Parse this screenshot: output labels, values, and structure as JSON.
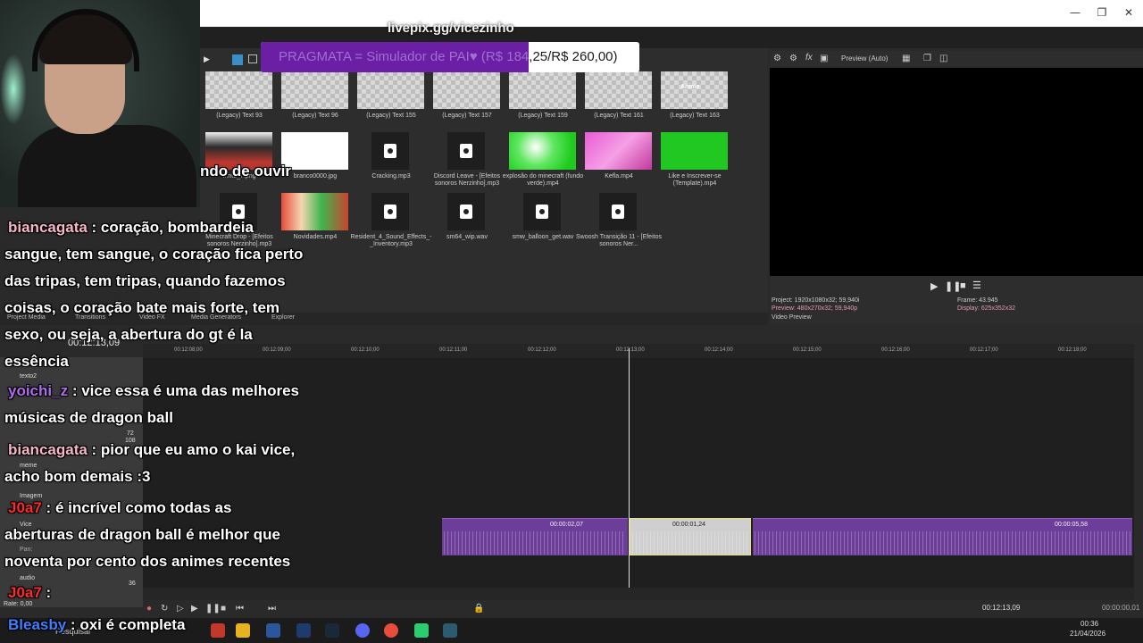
{
  "overlay": {
    "livepix": "livepix.gg/vicezinho",
    "donation": {
      "text": "PRAGMATA = Simulador de PAI♥ (R$ 184,25/R$ 260,00)",
      "text_pre": "PRAGMATA = Simulador de PAI♥ (R$ 184",
      "text_post": ",25/R$ 260,00)",
      "progress_fraction": 0.7087,
      "fill_color": "#6a1fa5"
    }
  },
  "chat": {
    "partial_line": "ndo de ouvir",
    "messages": [
      {
        "user": "biancagata",
        "user_color": "#f7b7c7",
        "lines": [
          "coração, bombardeia",
          "sangue, tem sangue, o coração fica perto",
          "das tripas, tem tripas, quando fazemos",
          "coisas, o coração bate mais forte, tem",
          "sexo, ou seja, a abertura do gt é la",
          "essência"
        ]
      },
      {
        "user": "yoichi_z",
        "user_color": "#b06cf0",
        "lines": [
          "vice essa é uma das melhores",
          "músicas de dragon ball"
        ]
      },
      {
        "user": "biancagata",
        "user_color": "#f7b7c7",
        "lines": [
          "pior que eu amo o kai vice,",
          "acho bom demais :3"
        ]
      },
      {
        "user": "J0a7",
        "user_color": "#ff2a2a",
        "lines": [
          "é incrível como todas as",
          "aberturas de dragon ball é melhor que",
          "noventa por cento dos animes recentes"
        ]
      },
      {
        "user": "J0a7",
        "user_color": "#ff2a2a",
        "lines": [
          ":"
        ]
      },
      {
        "user": "Bleasby",
        "user_color": "#3f7fff",
        "lines": [
          "oxi é completa"
        ]
      }
    ]
  },
  "window": {
    "minimize_icon": "minimize-icon",
    "restore_icon": "restore-icon",
    "close_icon": "close-icon"
  },
  "media": {
    "items": [
      {
        "label": "(Legacy) Text 93",
        "kind": "checker"
      },
      {
        "label": "(Legacy) Text 96",
        "kind": "checker"
      },
      {
        "label": "(Legacy) Text 155",
        "kind": "checker"
      },
      {
        "label": "(Legacy) Text 157",
        "kind": "checker"
      },
      {
        "label": "(Legacy) Text 159",
        "kind": "checker"
      },
      {
        "label": "(Legacy) Text 161",
        "kind": "checker"
      },
      {
        "label": "(Legacy) Text 163",
        "kind": "checker"
      },
      {
        "label": "...nte_7.png",
        "kind": "character"
      },
      {
        "label": "branco0000.jpg",
        "kind": "white"
      },
      {
        "label": "Cracking.mp3",
        "kind": "file"
      },
      {
        "label": "Discord Leave - [Efeitos sonoros Nerzinho].mp3",
        "kind": "file"
      },
      {
        "label": "explosão do minecraft (fundo verde).mp4",
        "kind": "green"
      },
      {
        "label": "Kefla.mp4",
        "kind": "pink"
      },
      {
        "label": "Like e Inscrever-se (Template).mp4",
        "kind": "greensolid"
      },
      {
        "label": "Minecraft Drop - [Efeitos sonoros Nerzinho].mp3",
        "kind": "file"
      },
      {
        "label": "Novidades.mp4",
        "kind": "characters"
      },
      {
        "label": "Resident_4_Sound_Effects_-_Inventory.mp3",
        "kind": "file"
      },
      {
        "label": "sm64_wip.wav",
        "kind": "file"
      },
      {
        "label": "smw_balloon_get.wav",
        "kind": "file"
      },
      {
        "label": "Swoosh Transição 11 - [Efeitos sonoros Ner...",
        "kind": "file"
      }
    ],
    "anime_tag": "Anime"
  },
  "tabs": [
    "Project Media",
    "Transitions",
    "Video FX",
    "Media Generators",
    "Explorer"
  ],
  "preview": {
    "mode": "Preview (Auto)",
    "project": "Project:  1920x1080x32; 59,940i",
    "preview_res": "Preview:  480x270x32; 59,940p",
    "frame": "Frame:     43.945",
    "display": "Display:   625x352x32",
    "tab": "Video Preview"
  },
  "timeline": {
    "position": "00:12:13,09",
    "rate": "Rate: 0,00",
    "ruler": [
      "00:12:08;00",
      "00:12:09;00",
      "00:12:10;00",
      "00:12:11;00",
      "00:12:12;00",
      "00:12:13;00",
      "00:12:14;00",
      "00:12:15;00",
      "00:12:16;00",
      "00:12:17;00",
      "00:12:18;00"
    ],
    "tracks": [
      "texto2",
      "meme",
      "Imagem",
      "Vice",
      "audio"
    ],
    "level": "72",
    "level2": "108",
    "level3": "36",
    "pan": "Pan:",
    "clips": [
      {
        "time": "00:00:02,07"
      },
      {
        "time": "00:00:01,24"
      },
      {
        "time": "00:00:05,58"
      }
    ],
    "cursor_time": "00:12:13,09",
    "end_time": "00:00:00,01"
  },
  "taskbar": {
    "search_label": "Pesquisar",
    "clock": "00:36",
    "date": "21/04/2026"
  }
}
